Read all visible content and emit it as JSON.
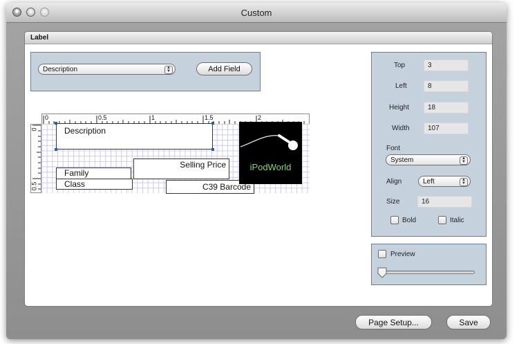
{
  "window": {
    "title": "Custom"
  },
  "panel": {
    "tab_label": "Label"
  },
  "field_selector": {
    "selected": "Description",
    "add_button": "Add Field"
  },
  "ruler": {
    "top_marks": [
      "0",
      "0.5",
      "1",
      "1.5",
      "2"
    ],
    "left_marks": [
      "0",
      "0.5"
    ]
  },
  "label_fields": {
    "description": "Description",
    "family": "Family",
    "class": "Class",
    "selling_price": "Selling Price",
    "barcode": "C39 Barcode",
    "logo_text": "iPodWorld"
  },
  "properties": {
    "top_label": "Top",
    "top_value": "3",
    "left_label": "Left",
    "left_value": "8",
    "height_label": "Height",
    "height_value": "18",
    "width_label": "Width",
    "width_value": "107",
    "font_label": "Font",
    "font_value": "System",
    "align_label": "Align",
    "align_value": "Left",
    "size_label": "Size",
    "size_value": "16",
    "bold_label": "Bold",
    "italic_label": "Italic",
    "bold_checked": false,
    "italic_checked": false
  },
  "preview": {
    "label": "Preview",
    "checked": false,
    "slider_value": 0
  },
  "footer": {
    "page_setup_button": "Page Setup...",
    "save_button": "Save"
  }
}
